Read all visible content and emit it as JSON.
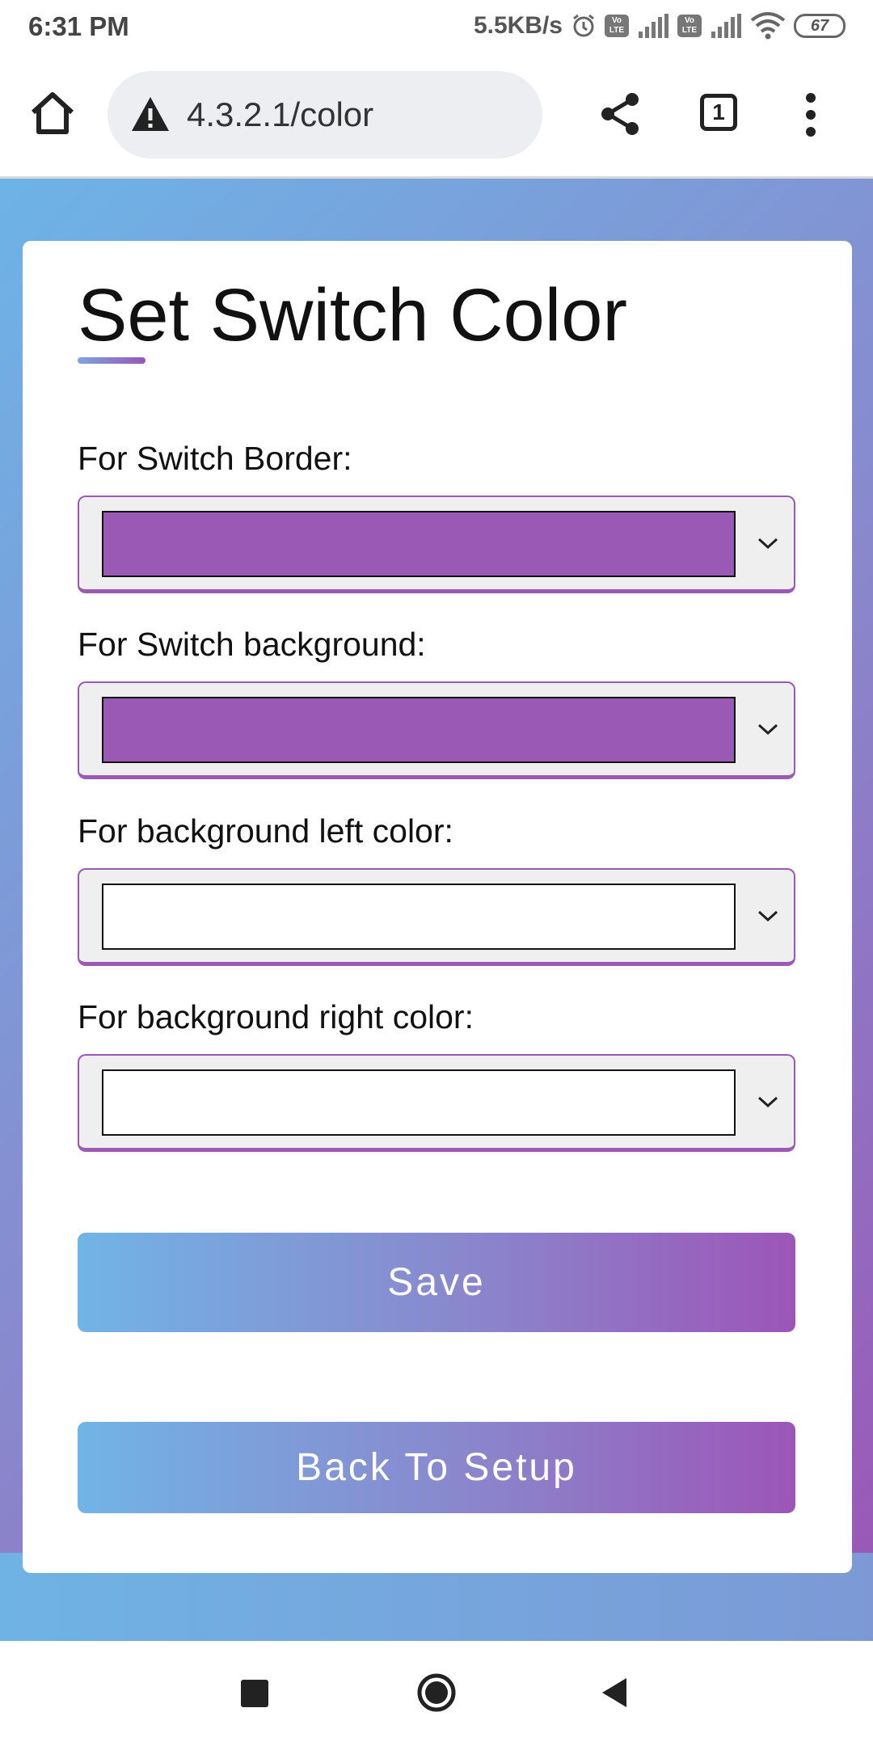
{
  "status_bar": {
    "time": "6:31 PM",
    "net_speed": "5.5KB/s",
    "battery": "67",
    "volte_label": "Vo LTE"
  },
  "browser": {
    "url": "4.3.2.1/color",
    "tab_count": "1"
  },
  "page": {
    "title": "Set Switch Color",
    "fields": [
      {
        "label": "For Switch Border:",
        "color": "#9b59b6"
      },
      {
        "label": "For Switch background:",
        "color": "#9b59b6"
      },
      {
        "label": "For background left color:",
        "color": "#ffffff"
      },
      {
        "label": "For background right color:",
        "color": "#ffffff"
      }
    ],
    "save_label": "Save",
    "back_label": "Back To Setup"
  },
  "colors": {
    "accent": "#9b59b6",
    "gradient_start": "#6db4e6",
    "gradient_end": "#9b55b5"
  }
}
